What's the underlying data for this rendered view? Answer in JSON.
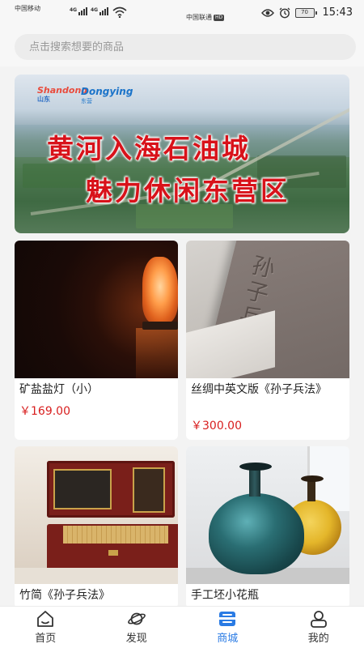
{
  "status_bar": {
    "carrier_1": "中国移动",
    "carrier_2": "中国联通",
    "hd_badge": "HD",
    "signal_1_gen": "4G",
    "signal_2_gen": "4G",
    "battery": "70",
    "time": "15:43"
  },
  "search": {
    "placeholder": "点击搜索想要的商品"
  },
  "banner": {
    "logo_1": "Shandong",
    "logo_1_sub": "山东",
    "logo_2": "Dongying",
    "logo_2_sub": "东营",
    "line_1": "黄河入海石油城",
    "line_2": "魅力休闲东营区"
  },
  "products": [
    {
      "name": "矿盐盐灯（小）",
      "price": "￥169.00"
    },
    {
      "name": "丝绸中英文版《孙子兵法》",
      "price": "￥300.00",
      "cover_text": "孙子兵法"
    },
    {
      "name": "竹简《孙子兵法》"
    },
    {
      "name": "手工坯小花瓶"
    }
  ],
  "tabs": [
    {
      "label": "首页",
      "icon": "home-icon"
    },
    {
      "label": "发现",
      "icon": "planet-icon"
    },
    {
      "label": "商城",
      "icon": "mall-icon",
      "active": true
    },
    {
      "label": "我的",
      "icon": "user-icon"
    }
  ],
  "colors": {
    "accent": "#2a7be4",
    "price": "#d81e1e"
  }
}
